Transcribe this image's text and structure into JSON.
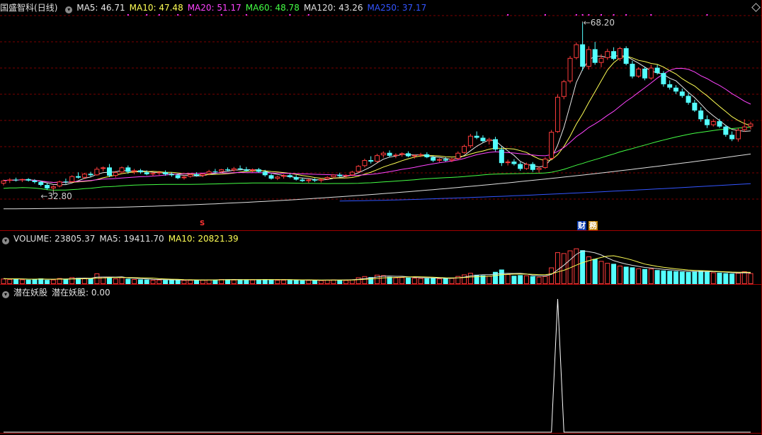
{
  "stock": {
    "name": "国盛智科",
    "period": "(日线)"
  },
  "price_legend": [
    {
      "label": "MA5: ",
      "value": "46.71",
      "color": "#e8e8e8"
    },
    {
      "label": "MA10: ",
      "value": "47.48",
      "color": "#ffff55"
    },
    {
      "label": "MA20: ",
      "value": "51.17",
      "color": "#ff44ff"
    },
    {
      "label": "MA60: ",
      "value": "48.78",
      "color": "#44ff44"
    },
    {
      "label": "MA120: ",
      "value": "43.26",
      "color": "#e0e0e0"
    },
    {
      "label": "MA250: ",
      "value": "37.17",
      "color": "#3355ff"
    }
  ],
  "price_marks": {
    "high": "68.20",
    "low": "32.80"
  },
  "badges": {
    "s": "S",
    "cai": "财",
    "wu": "務"
  },
  "volume_legend": [
    {
      "label": "VOLUME: ",
      "value": "23805.37",
      "color": "#e0e0e0"
    },
    {
      "label": "MA5: ",
      "value": "19411.70",
      "color": "#e0e0e0"
    },
    {
      "label": "MA10: ",
      "value": "20821.39",
      "color": "#ffff55"
    }
  ],
  "indicator_legend": {
    "name": "潜在妖股",
    "series": "潜在妖股: ",
    "value": "0.00"
  },
  "colors": {
    "up": "#ff3c3c",
    "down": "#54ffff",
    "grid": "#7a0000",
    "border": "#a00000"
  },
  "chart_data": {
    "type": "candlestick",
    "y_range": [
      30.5,
      72
    ],
    "candles": [
      [
        37.2,
        38,
        36.8,
        37.8
      ],
      [
        37.8,
        38.3,
        37.3,
        38
      ],
      [
        38,
        38.4,
        37.6,
        37.9
      ],
      [
        37.9,
        38.2,
        37.5,
        38.1
      ],
      [
        38.1,
        38.3,
        37.6,
        37.8
      ],
      [
        37.8,
        38.1,
        37.2,
        37.5
      ],
      [
        37.5,
        37.8,
        36.6,
        36.9
      ],
      [
        36.9,
        37.2,
        35.9,
        36.2
      ],
      [
        36.2,
        36.8,
        35.8,
        36.6
      ],
      [
        36.6,
        37.8,
        36.4,
        37.6
      ],
      [
        37.6,
        38.2,
        37.1,
        37.5
      ],
      [
        37.5,
        38.9,
        37.4,
        38.7
      ],
      [
        38.7,
        39.5,
        38.2,
        38.4
      ],
      [
        38.4,
        39.4,
        38.1,
        39.2
      ],
      [
        39.2,
        39.6,
        38.6,
        38.9
      ],
      [
        38.9,
        40.6,
        38.8,
        40.2
      ],
      [
        40.2,
        40.7,
        39.7,
        40.5
      ],
      [
        40.5,
        41.2,
        38.5,
        38.8
      ],
      [
        38.8,
        39.8,
        38.4,
        39.5
      ],
      [
        39.5,
        40.7,
        39.2,
        40.5
      ],
      [
        40.5,
        40.9,
        39.2,
        39.6
      ],
      [
        39.6,
        40.2,
        39.1,
        39.9
      ],
      [
        39.9,
        40.2,
        39.2,
        39.5
      ],
      [
        39.5,
        39.9,
        38.9,
        39.1
      ],
      [
        39.1,
        39.6,
        38.7,
        39.3
      ],
      [
        39.3,
        39.8,
        38.9,
        39.5
      ],
      [
        39.5,
        39.9,
        38.8,
        39.1
      ],
      [
        39.1,
        39.5,
        38.6,
        38.9
      ],
      [
        38.9,
        39.2,
        38.1,
        38.3
      ],
      [
        38.3,
        38.9,
        38,
        38.6
      ],
      [
        38.6,
        39.3,
        38.4,
        39.1
      ],
      [
        39.1,
        39.5,
        38.6,
        38.8
      ],
      [
        38.8,
        39.3,
        38.5,
        39.2
      ],
      [
        39.2,
        40,
        38.9,
        39.7
      ],
      [
        39.7,
        40.2,
        39.3,
        39.6
      ],
      [
        39.6,
        40.2,
        39.4,
        40.1
      ],
      [
        40.1,
        40.5,
        39.7,
        39.9
      ],
      [
        39.9,
        40.6,
        39.6,
        40.3
      ],
      [
        40.3,
        40.9,
        39.9,
        40.1
      ],
      [
        40.1,
        40.6,
        39.7,
        39.8
      ],
      [
        39.8,
        40.3,
        39.5,
        40.1
      ],
      [
        40.1,
        40.4,
        39.4,
        39.6
      ],
      [
        39.6,
        40,
        38.6,
        38.9
      ],
      [
        38.9,
        39.2,
        38,
        38.2
      ],
      [
        38.2,
        38.8,
        37.9,
        38.6
      ],
      [
        38.6,
        39.1,
        38.2,
        38.9
      ],
      [
        38.9,
        39.2,
        38.3,
        38.5
      ],
      [
        38.5,
        38.9,
        37.8,
        38
      ],
      [
        38,
        38.4,
        37.5,
        37.7
      ],
      [
        37.7,
        38.2,
        37.3,
        38
      ],
      [
        38,
        38.3,
        37.5,
        37.8
      ],
      [
        37.8,
        38.3,
        37.4,
        38.1
      ],
      [
        38.1,
        38.7,
        37.9,
        38.5
      ],
      [
        38.5,
        39.1,
        38.2,
        39
      ],
      [
        39,
        39.4,
        38.5,
        38.7
      ],
      [
        38.7,
        39.1,
        38.3,
        38.9
      ],
      [
        38.9,
        39.8,
        38.7,
        39.6
      ],
      [
        39.6,
        41,
        39.4,
        40.8
      ],
      [
        40.8,
        42.3,
        40.5,
        42
      ],
      [
        42,
        42.8,
        41.3,
        41.7
      ],
      [
        41.7,
        43.3,
        41.5,
        43
      ],
      [
        43,
        43.8,
        42.5,
        43.5
      ],
      [
        43.5,
        44,
        42.6,
        42.9
      ],
      [
        42.9,
        43.4,
        42.4,
        43.1
      ],
      [
        43.1,
        43.6,
        42.7,
        43.4
      ],
      [
        43.4,
        43.8,
        42.6,
        42.8
      ],
      [
        42.8,
        43.2,
        42.3,
        43
      ],
      [
        43,
        43.5,
        42.6,
        43.2
      ],
      [
        43.2,
        43.6,
        42.4,
        42.6
      ],
      [
        42.6,
        42.9,
        41.6,
        41.9
      ],
      [
        41.9,
        42.4,
        41.6,
        42.2
      ],
      [
        42.2,
        42.6,
        41.7,
        41.9
      ],
      [
        41.9,
        42.5,
        41.6,
        42.3
      ],
      [
        42.3,
        43.8,
        42.1,
        43.5
      ],
      [
        43.5,
        45.2,
        43.3,
        44.9
      ],
      [
        44.9,
        47.4,
        44.5,
        47
      ],
      [
        47,
        47.9,
        46.3,
        46.6
      ],
      [
        46.6,
        47.1,
        45.6,
        45.9
      ],
      [
        45.9,
        46.6,
        45.2,
        46.3
      ],
      [
        46.3,
        46.8,
        43.8,
        44.2
      ],
      [
        44.2,
        44.8,
        40.8,
        41.4
      ],
      [
        41.4,
        42.1,
        40.9,
        41.7
      ],
      [
        41.7,
        42.2,
        40.9,
        41.2
      ],
      [
        41.2,
        41.6,
        39.8,
        40.2
      ],
      [
        40.2,
        41.5,
        40,
        41.2
      ],
      [
        41.2,
        41.6,
        39.6,
        40
      ],
      [
        40,
        40.7,
        39.4,
        40.4
      ],
      [
        40.4,
        42.6,
        40.2,
        42.3
      ],
      [
        42.3,
        48.2,
        42.1,
        47.8
      ],
      [
        47.8,
        55.5,
        47.6,
        55
      ],
      [
        55,
        58.5,
        54.5,
        58.2
      ],
      [
        58.2,
        63.4,
        57.8,
        63
      ],
      [
        63,
        66.2,
        62.7,
        65.8
      ],
      [
        65.8,
        70.2,
        60.4,
        61.2
      ],
      [
        61.2,
        65.4,
        60.6,
        64.8
      ],
      [
        64.8,
        66.3,
        61.6,
        62
      ],
      [
        62,
        63.8,
        61.1,
        63
      ],
      [
        63,
        64.9,
        62.6,
        64.4
      ],
      [
        64.4,
        65.2,
        62.5,
        62.8
      ],
      [
        62.8,
        65.3,
        62.4,
        65
      ],
      [
        65,
        65.4,
        61.5,
        61.8
      ],
      [
        61.8,
        62.4,
        58.8,
        59.2
      ],
      [
        59.2,
        61.1,
        58.9,
        60.8
      ],
      [
        60.8,
        61.2,
        58.4,
        58.8
      ],
      [
        58.8,
        61.6,
        58.5,
        61
      ],
      [
        61,
        61.6,
        59.6,
        59.9
      ],
      [
        59.9,
        60.3,
        57.1,
        57.6
      ],
      [
        57.6,
        58.4,
        56.5,
        56.9
      ],
      [
        56.9,
        57.4,
        55.6,
        56.1
      ],
      [
        56.1,
        56.7,
        54.8,
        55.2
      ],
      [
        55.2,
        55.8,
        53.4,
        53.8
      ],
      [
        53.8,
        54.4,
        51.9,
        52.2
      ],
      [
        52.2,
        52.9,
        49.9,
        50.4
      ],
      [
        50.4,
        51.2,
        48.6,
        49.2
      ],
      [
        49.2,
        50.4,
        48.9,
        50
      ],
      [
        50,
        50.5,
        48.6,
        48.9
      ],
      [
        48.9,
        49.2,
        46.8,
        47.2
      ],
      [
        47.2,
        47.9,
        45.9,
        46.3
      ],
      [
        46.3,
        48.6,
        45.8,
        48.2
      ],
      [
        48.2,
        50.4,
        47.8,
        48.9
      ],
      [
        48.9,
        49.9,
        48.3,
        49.5
      ]
    ],
    "volume_range": [
      0,
      30000
    ],
    "volume": [
      4200,
      3900,
      4100,
      3600,
      3400,
      3800,
      4400,
      3200,
      3500,
      4600,
      3900,
      5300,
      4800,
      4500,
      4100,
      8200,
      5600,
      4900,
      4300,
      5200,
      4100,
      3800,
      3600,
      3500,
      3300,
      3400,
      3200,
      3000,
      3300,
      3100,
      3200,
      3000,
      3300,
      3500,
      3300,
      3800,
      3600,
      3400,
      3300,
      3200,
      3400,
      3500,
      3800,
      3400,
      3200,
      3300,
      3100,
      3000,
      2900,
      3100,
      2900,
      3000,
      3300,
      3500,
      3200,
      3100,
      3600,
      5200,
      6100,
      5400,
      7200,
      6800,
      5600,
      5100,
      5300,
      5000,
      4800,
      4600,
      4500,
      4700,
      4300,
      4500,
      4700,
      6200,
      7400,
      8600,
      7200,
      6700,
      6300,
      9400,
      11200,
      7600,
      6400,
      6900,
      6700,
      6100,
      5600,
      6200,
      12800,
      24500,
      23800,
      25900,
      27500,
      26100,
      21300,
      19400,
      17800,
      16300,
      15600,
      14200,
      13400,
      12900,
      12100,
      11600,
      11900,
      10800,
      10500,
      10200,
      9900,
      9600,
      9300,
      9800,
      10300,
      9500,
      9000,
      8800,
      8400,
      8100,
      8600,
      9800,
      8400
    ],
    "indicator_range": [
      0,
      1
    ],
    "indicator_values": [
      0,
      0,
      0,
      0,
      0,
      0,
      0,
      0,
      0,
      0,
      0,
      0,
      0,
      0,
      0,
      0,
      0,
      0,
      0,
      0,
      0,
      0,
      0,
      0,
      0,
      0,
      0,
      0,
      0,
      0,
      0,
      0,
      0,
      0,
      0,
      0,
      0,
      0,
      0,
      0,
      0,
      0,
      0,
      0,
      0,
      0,
      0,
      0,
      0,
      0,
      0,
      0,
      0,
      0,
      0,
      0,
      0,
      0,
      0,
      0,
      0,
      0,
      0,
      0,
      0,
      0,
      0,
      0,
      0,
      0,
      0,
      0,
      0,
      0,
      0,
      0,
      0,
      0,
      0,
      0,
      0,
      0,
      0,
      0,
      0,
      0,
      0,
      0,
      0,
      1,
      0,
      0,
      0,
      0,
      0,
      0,
      0,
      0,
      0,
      0,
      0,
      0,
      0,
      0,
      0,
      0,
      0,
      0,
      0,
      0,
      0,
      0,
      0,
      0,
      0,
      0,
      0,
      0,
      0,
      0,
      0
    ]
  }
}
